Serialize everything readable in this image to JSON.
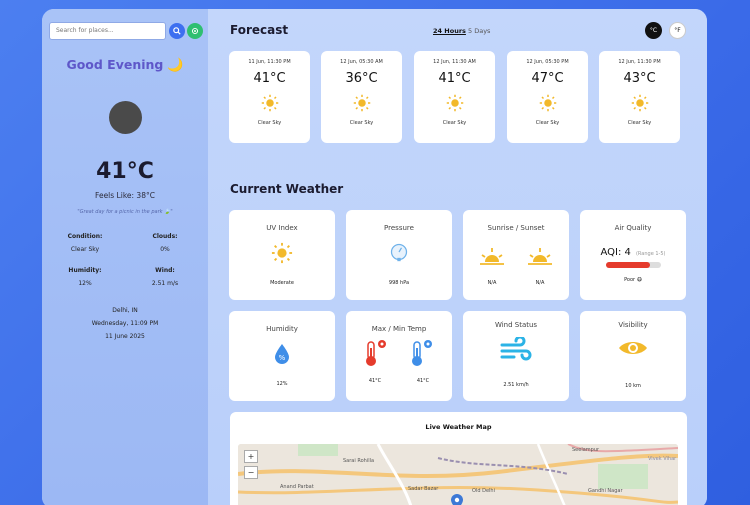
{
  "search": {
    "placeholder": "Search for places..."
  },
  "sidebar": {
    "greeting": "Good Evening",
    "temperature": "41°C",
    "feels_like": "Feels Like: 38°C",
    "quote": "\"Great day for a picnic in the park 🍃\"",
    "condition_label": "Condition:",
    "condition_value": "Clear Sky",
    "clouds_label": "Clouds:",
    "clouds_value": "0%",
    "humidity_label": "Humidity:",
    "humidity_value": "12%",
    "wind_label": "Wind:",
    "wind_value": "2.51 m/s",
    "location": "Delhi, IN",
    "datetime": "Wednesday, 11:09 PM",
    "date": "11 June 2025"
  },
  "forecast": {
    "title": "Forecast",
    "tabs": [
      "24 Hours",
      "5 Days"
    ],
    "units": [
      "°C",
      "°F"
    ],
    "cards": [
      {
        "time": "11 Jun, 11:30 PM",
        "temp": "41°C",
        "cond": "Clear Sky"
      },
      {
        "time": "12 Jun, 05:30 AM",
        "temp": "36°C",
        "cond": "Clear Sky"
      },
      {
        "time": "12 Jun, 11:30 AM",
        "temp": "41°C",
        "cond": "Clear Sky"
      },
      {
        "time": "12 Jun, 05:30 PM",
        "temp": "47°C",
        "cond": "Clear Sky"
      },
      {
        "time": "12 Jun, 11:30 PM",
        "temp": "43°C",
        "cond": "Clear Sky"
      }
    ]
  },
  "current": {
    "title": "Current Weather",
    "uv": {
      "label": "UV Index",
      "value": "Moderate"
    },
    "pressure": {
      "label": "Pressure",
      "value": "998 hPa"
    },
    "sun": {
      "label": "Sunrise / Sunset",
      "sunrise": "N/A",
      "sunset": "N/A"
    },
    "aqi": {
      "label": "Air Quality",
      "value": "AQI: 4",
      "range": "(Range 1-5)",
      "status": "Poor 😷",
      "level": 0.8
    },
    "humidity": {
      "label": "Humidity",
      "value": "12%"
    },
    "maxmin": {
      "label": "Max / Min Temp",
      "max": "41°C",
      "min": "41°C"
    },
    "wind": {
      "label": "Wind Status",
      "value": "2.51 km/h"
    },
    "visibility": {
      "label": "Visibility",
      "value": "10 km"
    }
  },
  "map": {
    "title": "Live Weather Map",
    "zoom_in": "+",
    "zoom_out": "−",
    "places": [
      "Sarai Rohilla",
      "Anand Parbat",
      "Sadar Bazar",
      "Old Delhi",
      "Gandhi Nagar",
      "Seelampur",
      "Vivek Vihar"
    ]
  },
  "colors": {
    "accent": "#3d6ff0",
    "greeting": "#5e57c9",
    "sun": "#f2b92b",
    "drop": "#3f8ee8",
    "aqi_bar": "#e53b2c"
  }
}
